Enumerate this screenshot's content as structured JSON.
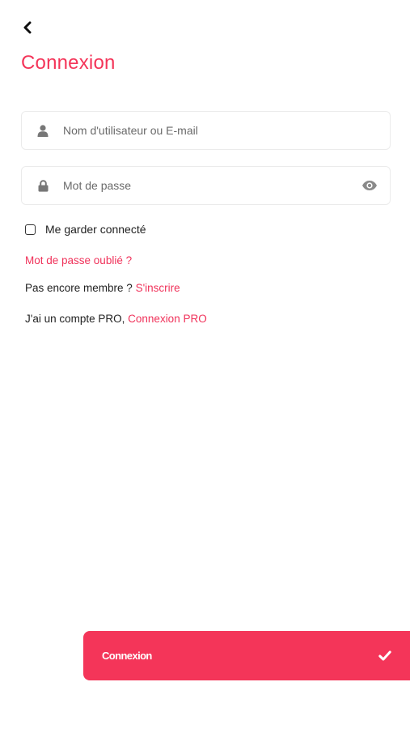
{
  "colors": {
    "accent": "#f43559",
    "link": "#f0325a",
    "icon_gray": "#777777",
    "border": "#ebebeb"
  },
  "header": {
    "back_icon": "chevron-left-icon",
    "title": "Connexion"
  },
  "form": {
    "username": {
      "icon": "user-icon",
      "placeholder": "Nom d'utilisateur ou E-mail",
      "value": ""
    },
    "password": {
      "icon": "lock-icon",
      "placeholder": "Mot de passe",
      "value": "",
      "toggle_icon": "eye-icon"
    },
    "remember": {
      "label": "Me garder connecté",
      "checked": false
    }
  },
  "links": {
    "forgot": "Mot de passe oublié ?",
    "not_member_text": "Pas encore membre ?",
    "signup": "S'inscrire",
    "pro_text": "J'ai un compte PRO,",
    "pro_login": "Connexion PRO"
  },
  "submit": {
    "label": "Connexion",
    "icon": "check-icon"
  }
}
